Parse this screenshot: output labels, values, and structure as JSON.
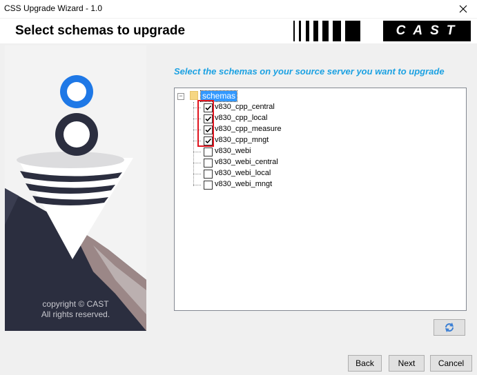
{
  "window": {
    "title": "CSS Upgrade Wizard - 1.0"
  },
  "header": {
    "heading": "Select schemas to upgrade",
    "logo_text": "CAST"
  },
  "art": {
    "copyright_line1": "copyright © CAST",
    "copyright_line2": "All rights reserved."
  },
  "instruction": "Select the schemas on your source server you want to upgrade",
  "tree": {
    "root_label": "schemas",
    "root_expander": "−",
    "items": [
      {
        "label": "v830_cpp_central",
        "checked": true
      },
      {
        "label": "v830_cpp_local",
        "checked": true
      },
      {
        "label": "v830_cpp_measure",
        "checked": true
      },
      {
        "label": "v830_cpp_mngt",
        "checked": true
      },
      {
        "label": "v830_webi",
        "checked": false
      },
      {
        "label": "v830_webi_central",
        "checked": false
      },
      {
        "label": "v830_webi_local",
        "checked": false
      },
      {
        "label": "v830_webi_mngt",
        "checked": false
      }
    ]
  },
  "buttons": {
    "back": "Back",
    "next": "Next",
    "cancel": "Cancel"
  },
  "icons": {
    "close": "close-icon",
    "refresh": "refresh-icon",
    "folder": "folder-icon",
    "checkmark": "checkmark-icon"
  },
  "colors": {
    "accent": "#1ba1e2",
    "selection": "#3399ff",
    "highlight_box": "#e0141e",
    "art_dark": "#2b2e3f"
  }
}
